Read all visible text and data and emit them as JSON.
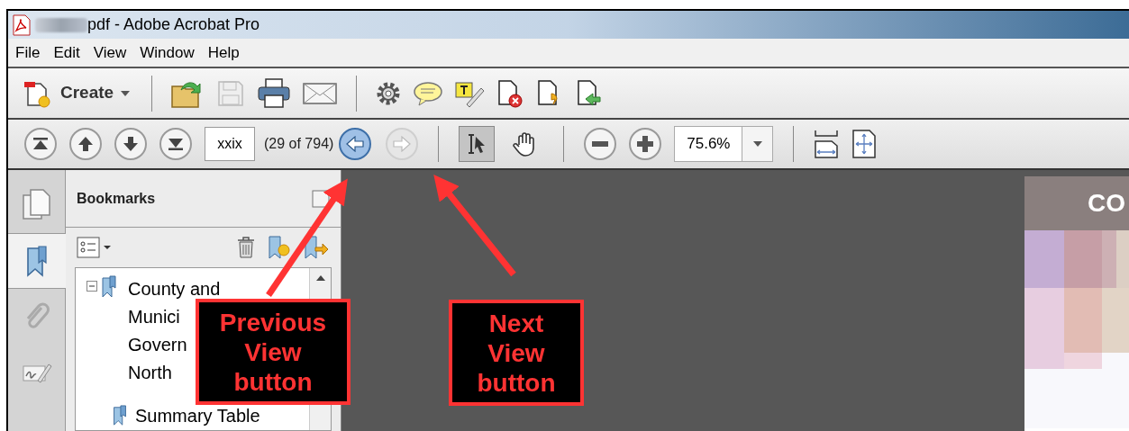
{
  "window": {
    "title": "pdf - Adobe Acrobat Pro"
  },
  "menu": [
    "File",
    "Edit",
    "View",
    "Window",
    "Help"
  ],
  "toolbar": {
    "create": "Create",
    "save_disabled": true
  },
  "navigation": {
    "page_field": "xxix",
    "page_count": "(29 of 794)",
    "previous_view_disabled": false,
    "next_view_disabled": true,
    "tools": [
      {
        "kind": "select",
        "selected": true
      },
      {
        "kind": "hand",
        "selected": false
      }
    ],
    "zoom": "75.6%"
  },
  "sidebar": {
    "tabs": [
      {
        "kind": "pages",
        "selected": false
      },
      {
        "kind": "bookmarks",
        "selected": true
      },
      {
        "kind": "attachments",
        "selected": false
      },
      {
        "kind": "signatures",
        "selected": false
      }
    ],
    "panel_title": "Bookmarks",
    "bookmarks": [
      {
        "lines": [
          "County and",
          "Munici",
          "Govern",
          "North"
        ],
        "expanded": true,
        "children": [
          {
            "lines": [
              "Summary Table"
            ]
          }
        ]
      }
    ]
  },
  "document": {
    "heading": "CO"
  },
  "callouts": [
    {
      "text": "Previous View button"
    },
    {
      "text": "Next View button"
    }
  ]
}
